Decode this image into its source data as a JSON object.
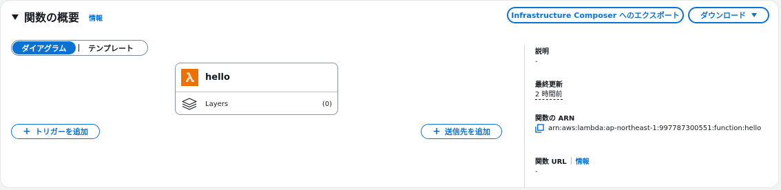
{
  "header": {
    "title": "関数の概要",
    "info_link": "情報",
    "export_button": "Infrastructure Composer へのエクスポート",
    "download_button": "ダウンロード"
  },
  "view_toggle": {
    "options": [
      "ダイアグラム",
      "テンプレート"
    ],
    "selected": "ダイアグラム"
  },
  "function_card": {
    "name": "hello",
    "icon": "lambda-icon",
    "icon_color": "#ed7100",
    "layers_label": "Layers",
    "layers_count": "(0)"
  },
  "actions": {
    "add_trigger": "トリガーを追加",
    "add_destination": "送信先を追加"
  },
  "details": {
    "description_label": "説明",
    "description_value": "-",
    "last_modified_label": "最終更新",
    "last_modified_value": "2 時間前",
    "arn_label": "関数の ARN",
    "arn_value": "arn:aws:lambda:ap-northeast-1:997787300551:function:hello",
    "url_label": "関数 URL",
    "url_info_link": "情報",
    "url_value": "-"
  },
  "colors": {
    "accent": "#0972d3",
    "lambda_orange": "#ed7100"
  }
}
